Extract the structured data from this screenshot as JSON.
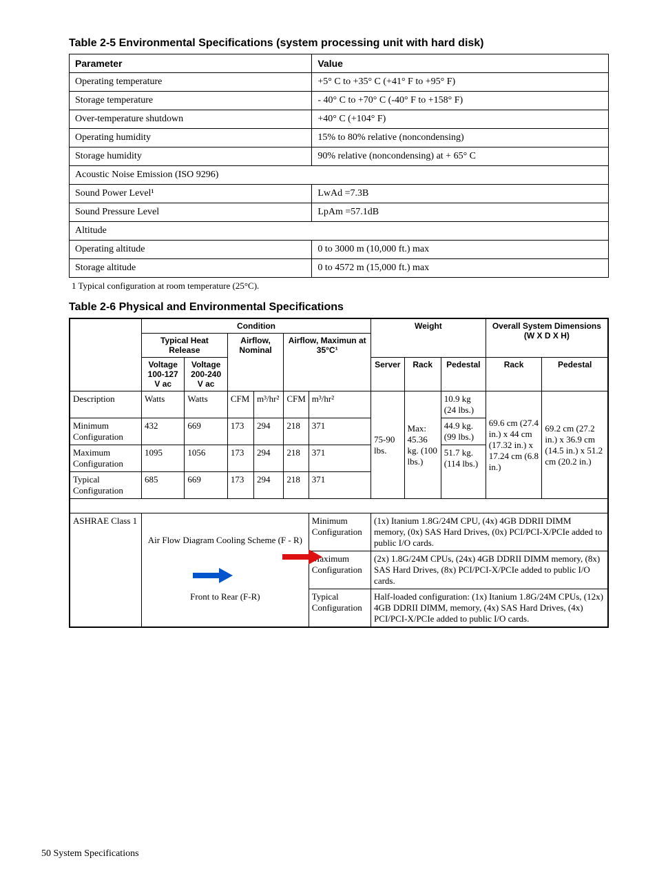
{
  "table25_title": "Table  2-5  Environmental Specifications (system processing unit with hard disk)",
  "table25": {
    "head": [
      "Parameter",
      "Value"
    ],
    "rows": [
      [
        "Operating temperature",
        "+5° C to +35° C (+41° F to +95° F)"
      ],
      [
        "Storage temperature",
        "- 40° C to +70° C (-40° F to +158° F)"
      ],
      [
        "Over-temperature shutdown",
        "+40° C (+104° F)"
      ],
      [
        "Operating humidity",
        "15% to 80% relative (noncondensing)"
      ],
      [
        "Storage humidity",
        "90% relative (noncondensing) at + 65° C"
      ],
      [
        "Acoustic Noise Emission (ISO 9296)",
        ""
      ],
      [
        "Sound Power Level¹",
        "LwAd =7.3B"
      ],
      [
        "Sound Pressure Level",
        "LpAm =57.1dB"
      ],
      [
        "Altitude",
        ""
      ],
      [
        "Operating altitude",
        "0 to 3000 m (10,000 ft.) max"
      ],
      [
        "Storage altitude",
        "0 to 4572 m (15,000 ft.) max"
      ]
    ]
  },
  "fn25": "1    Typical configuration at room temperature (25°C).",
  "table26_title": "Table  2-6  Physical and Environmental Specifications",
  "t26": {
    "cond": "Condition",
    "thr": "Typical Heat Release",
    "af_nom": "Airflow, Nominal",
    "af_max": "Airflow, Maximun at 35°C¹",
    "v1": "Voltage 100-127 V ac",
    "v2": "Voltage 200-240 V ac",
    "weight": "Weight",
    "osd": "Overall System Dimensions (W X D X H)",
    "server": "Server",
    "rack": "Rack",
    "pedestal": "Pedestal",
    "desc": "Description",
    "watts": "Watts",
    "cfm": "CFM",
    "m3hr": "m³/hr²",
    "r_min": [
      "Minimum Configuration",
      "432",
      "669",
      "173",
      "294",
      "218",
      "371"
    ],
    "r_max": [
      "Maximum Configuration",
      "1095",
      "1056",
      "173",
      "294",
      "218",
      "371"
    ],
    "r_typ": [
      "Typical Configuration",
      "685",
      "669",
      "173",
      "294",
      "218",
      "371"
    ],
    "w_server": "75-90 lbs.",
    "w_rack": "Max: 45.36 kg. (100 lbs.)",
    "w_ped_1": "10.9 kg (24 lbs.)",
    "w_ped_2": "44.9 kg. (99 lbs.)",
    "w_ped_3": "51.7 kg. (114 lbs.)",
    "d_rack_1": "69.6 cm (27.4 in.) x 44 cm (17.32 in.) x 17.24 cm (6.8 in.)",
    "d_ped_1": "69.2 cm (27.2 in.) x 36.9 cm (14.5 in.) x 51.2 cm (20.2 in.)",
    "ashrae": "ASHRAE Class 1",
    "flow_caption": "Air Flow Diagram Cooling Scheme (F - R)",
    "flow_sub": "Front to Rear (F-R)",
    "cfg_min": "(1x) Itanium 1.8G/24M CPU, (4x) 4GB DDRII DIMM memory, (0x) SAS Hard Drives, (0x) PCI/PCI-X/PCIe added to public I/O cards.",
    "cfg_max": "(2x) 1.8G/24M CPUs, (24x) 4GB DDRII DIMM memory, (8x) SAS Hard Drives, (8x) PCI/PCI-X/PCIe added to public I/O cards.",
    "cfg_typ": "Half-loaded configuration: (1x) Itanium 1.8G/24M CPUs, (12x) 4GB DDRII DIMM, memory, (4x) SAS Hard Drives, (4x) PCI/PCI-X/PCIe added to public I/O cards.",
    "min_lbl": "Minimum Configuration",
    "max_lbl": "Maximum Configuration",
    "typ_lbl": "Typical Configuration"
  },
  "footer": "50      System Specifications"
}
